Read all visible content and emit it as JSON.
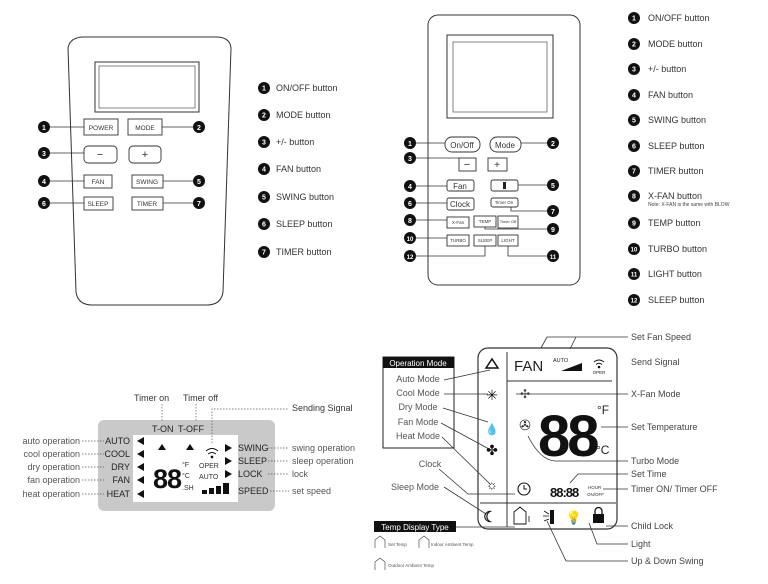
{
  "remote1": {
    "buttons": {
      "power": "POWER",
      "mode": "MODE",
      "minus": "−",
      "plus": "+",
      "fan": "FAN",
      "swing": "SWING",
      "sleep": "SLEEP",
      "timer": "TIMER"
    },
    "badges": [
      "1",
      "2",
      "3",
      "4",
      "5",
      "6",
      "7"
    ]
  },
  "list1": [
    {
      "num": "1",
      "label": "ON/OFF button"
    },
    {
      "num": "2",
      "label": "MODE button"
    },
    {
      "num": "3",
      "label": "+/- button"
    },
    {
      "num": "4",
      "label": "FAN button"
    },
    {
      "num": "5",
      "label": "SWING button"
    },
    {
      "num": "6",
      "label": "SLEEP button"
    },
    {
      "num": "7",
      "label": "TIMER button"
    }
  ],
  "remote2": {
    "buttons": {
      "onoff": "On/Off",
      "mode": "Mode",
      "minus": "−",
      "plus": "+",
      "fan": "Fan",
      "clock": "Clock",
      "timer_on": "Timer On",
      "xfan": "X-Fan",
      "temp": "TEMP",
      "timer_off": "Timer Off",
      "turbo": "TURBO",
      "sleep": "SLEEP",
      "light": "LIGHT"
    },
    "badges": [
      "1",
      "2",
      "3",
      "4",
      "5",
      "6",
      "7",
      "8",
      "9",
      "10",
      "11",
      "12"
    ]
  },
  "list2": [
    {
      "num": "1",
      "label": "ON/OFF button"
    },
    {
      "num": "2",
      "label": "MODE button"
    },
    {
      "num": "3",
      "label": "+/- button"
    },
    {
      "num": "4",
      "label": "FAN button"
    },
    {
      "num": "5",
      "label": "SWING button"
    },
    {
      "num": "6",
      "label": "SLEEP button"
    },
    {
      "num": "7",
      "label": "TIMER button"
    },
    {
      "num": "8",
      "label": "X-FAN button",
      "note": "Note: X-FAN is the same with BLOW"
    },
    {
      "num": "9",
      "label": "TEMP button"
    },
    {
      "num": "10",
      "label": "TURBO button"
    },
    {
      "num": "11",
      "label": "LIGHT button"
    },
    {
      "num": "12",
      "label": "SLEEP button"
    }
  ],
  "lcd1": {
    "timer_on": "Timer on",
    "timer_off": "Timer off",
    "sending_signal": "Sending Signal",
    "t_on": "T-ON",
    "t_off": "T-OFF",
    "modes": [
      "AUTO",
      "COOL",
      "DRY",
      "FAN",
      "HEAT"
    ],
    "mode_desc": [
      "auto operation",
      "cool operation",
      "dry operation",
      "fan operation",
      "heat operation"
    ],
    "right": [
      "SWING",
      "SLEEP",
      "LOCK",
      "SPEED"
    ],
    "right_desc": [
      "swing operation",
      "sleep operation",
      "lock",
      "set speed"
    ],
    "digits": "88",
    "deg_f": "°F",
    "deg_c": "°C",
    "sh": ".SH",
    "oper": "OPER",
    "auto": "AUTO"
  },
  "lcd2": {
    "operation_mode": "Operation Mode",
    "modes": [
      "Auto Mode",
      "Cool Mode",
      "Dry Mode",
      "Fan Mode",
      "Heat Mode"
    ],
    "clock": "Clock",
    "sleep_mode": "Sleep Mode",
    "temp_display_type": "Temp Display Type",
    "legend": {
      "set_temp": "Set Temp",
      "indoor": "Indoor Ambient Temp",
      "outdoor": "Outdoor Ambient Temp"
    },
    "fan": "FAN",
    "auto": "AUTO",
    "oper": "OPER",
    "digits": "88",
    "deg_f": "°F",
    "deg_c": "°C",
    "time": "88:88",
    "hour": "HOUR",
    "onoff": "ON/OFF",
    "callouts": [
      "Set Fan Speed",
      "Send Signal",
      "X-Fan Mode",
      "Set Temperature",
      "Turbo Mode",
      "Set Time",
      "Timer ON/ Timer OFF",
      "Child Lock",
      "Light",
      "Up & Down Swing"
    ]
  }
}
